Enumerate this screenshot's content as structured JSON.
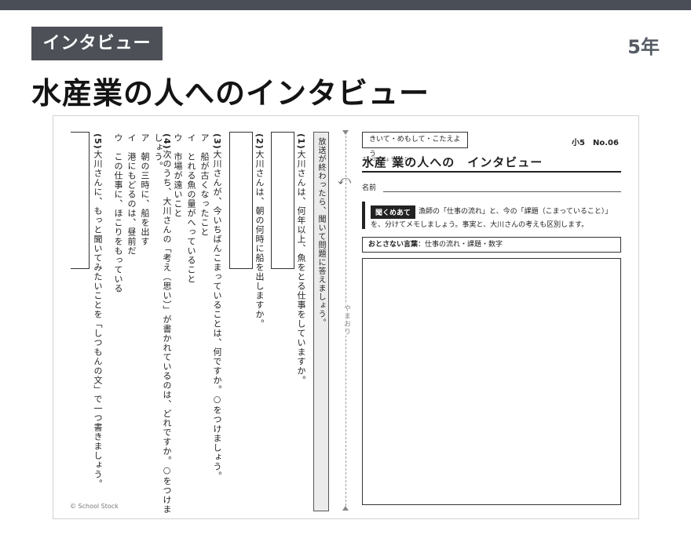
{
  "header": {
    "badge": "インタビュー",
    "grade": "5年",
    "title": "水産業の人へのインタビュー"
  },
  "left_page": {
    "q1_num": "(1)",
    "q1_text": "大川さんは、何年以上、魚をとる仕事をしていますか。",
    "q2_num": "(2)",
    "q2_text": "大川さんは、朝の何時に船を出しますか。",
    "q3_num": "(3)",
    "q3_text": "大川さんが、今いちばんこまっていることは、何ですか。○をつけましょう。",
    "q3_options": [
      "ア　船が古くなったこと",
      "イ　とれる魚の量がへっていること",
      "ウ　市場が遠いこと"
    ],
    "q4_num": "(4)",
    "q4_text": "次のうち、大川さんの「考え（思い）」が書かれているのは、どれですか。○をつけましょう。",
    "q4_options": [
      "ア　朝の三時に、船を出す",
      "イ　港にもどるのは、昼前だ",
      "ウ　この仕事に、ほこりをもっている"
    ],
    "q5_num": "(5)",
    "q5_text": "大川さんに、もっと聞いてみたいことを「しつもんの文」で一つ書きましょう。",
    "instruction": "放送が終わったら、聞いて問題に答えましょう。",
    "copyright": "© School Stock"
  },
  "fold": {
    "label": "やまおり",
    "icon": "fold-arrow-icon"
  },
  "right_page": {
    "tag": "きいて・めもして・こたえよう",
    "series": "小5　No.06",
    "title": "水産 業の人への　インタビュー",
    "title_ruby": "すいさんぎょう　　ひと",
    "name_label": "名前",
    "task_tag": "聞くめあて",
    "task_line1": "漁師の「仕事の流れ」と、今の「課題（こまっていること）」",
    "task_line2": "を、分けてメモしましょう。事実と、大川さんの考えも区別します。",
    "kotoba_label": "おとさない言葉",
    "kotoba_text": "：仕事の流れ・課題・数字"
  }
}
